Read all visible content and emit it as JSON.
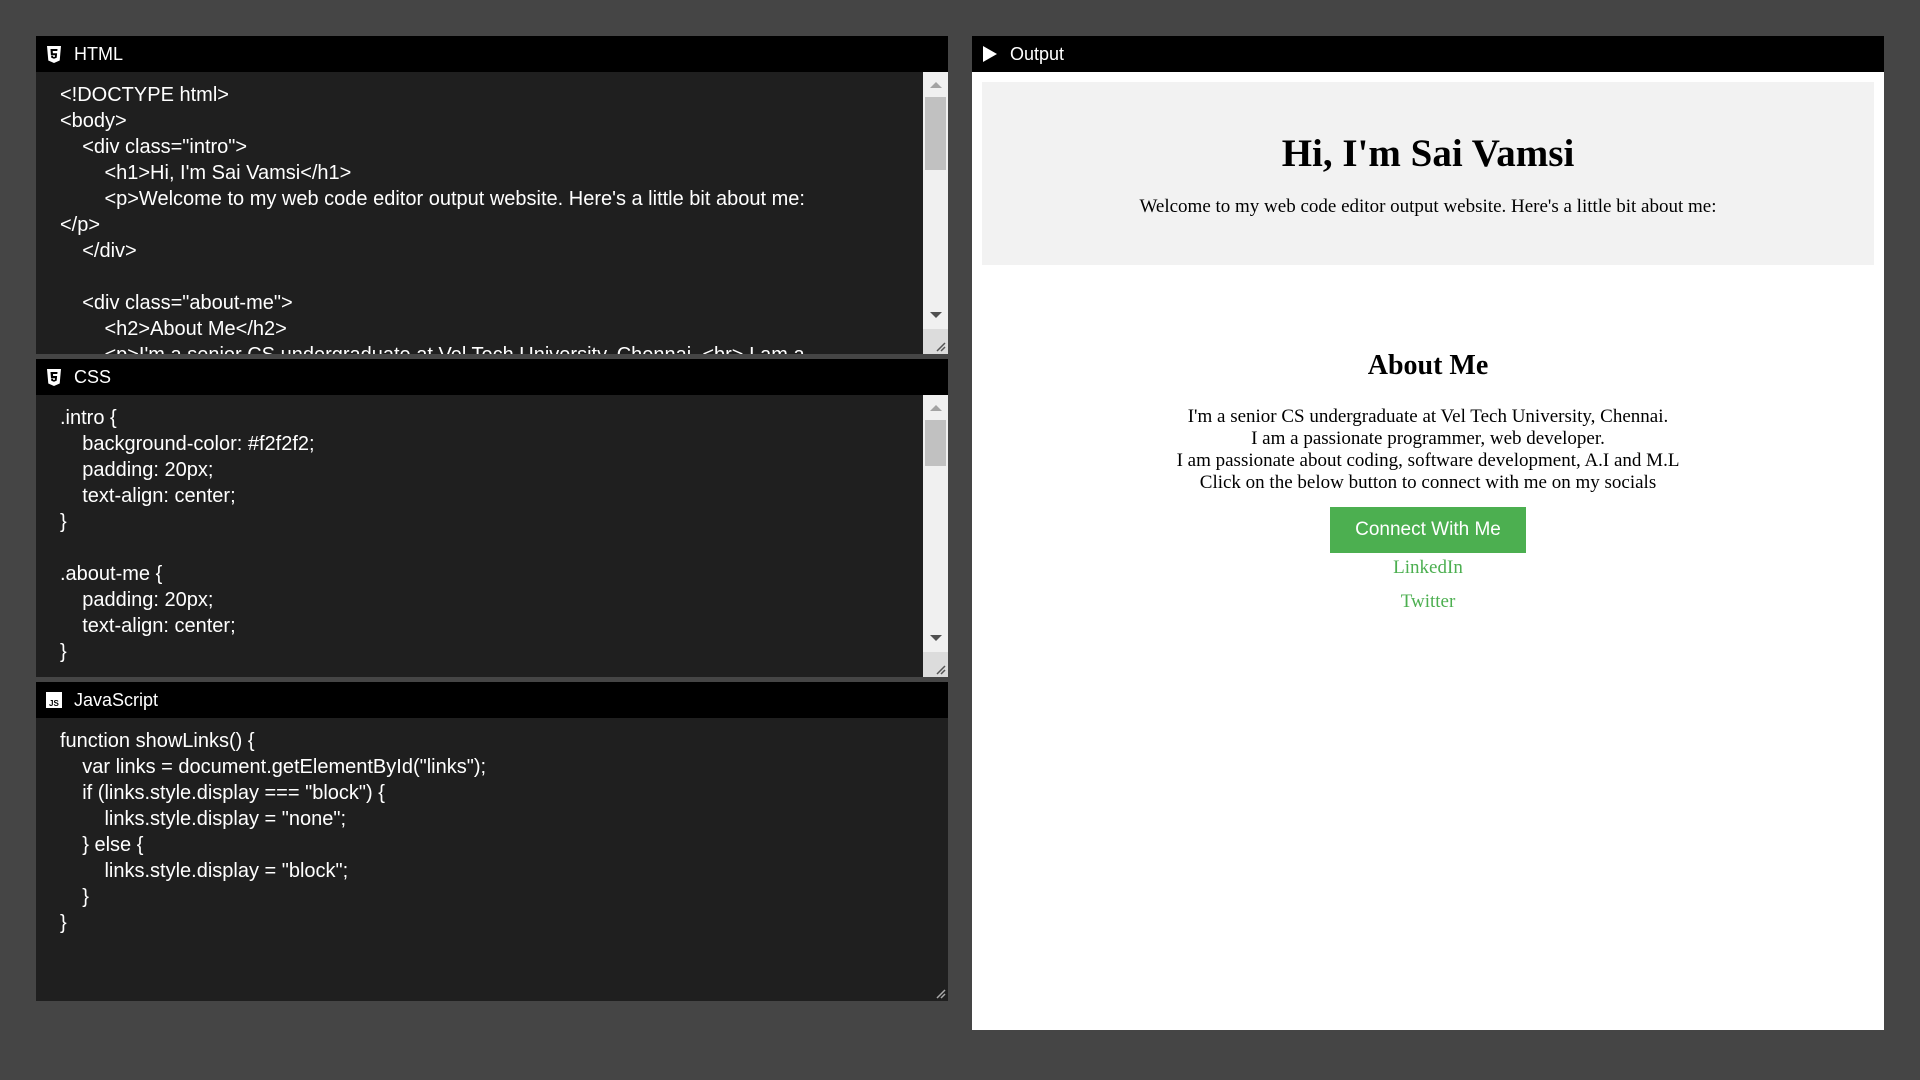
{
  "panels": {
    "html": {
      "title": "HTML",
      "icon": "html5-icon",
      "lines": [
        "<!DOCTYPE html>",
        "<body>",
        "    <div class=\"intro\">",
        "        <h1>Hi, I'm Sai Vamsi</h1>",
        "        <p>Welcome to my web code editor output website. Here's a little bit about me:",
        "</p>",
        "    </div>",
        "",
        "    <div class=\"about-me\">",
        "        <h2>About Me</h2>",
        "        <p>I'm a senior CS undergraduate at Vel Tech University, Chennai. <br> I am a"
      ],
      "scroll_position": 0.0
    },
    "css": {
      "title": "CSS",
      "icon": "css3-icon",
      "lines": [
        ".intro {",
        "    background-color: #f2f2f2;",
        "    padding: 20px;",
        "    text-align: center;",
        "}",
        "",
        ".about-me {",
        "    padding: 20px;",
        "    text-align: center;",
        "}"
      ],
      "scroll_position": 0.0
    },
    "js": {
      "title": "JavaScript",
      "icon": "js-icon",
      "lines": [
        "function showLinks() {",
        "    var links = document.getElementById(\"links\");",
        "    if (links.style.display === \"block\") {",
        "        links.style.display = \"none\";",
        "    } else {",
        "        links.style.display = \"block\";",
        "    }",
        "}"
      ]
    },
    "output": {
      "title": "Output",
      "icon": "play-icon"
    }
  },
  "preview": {
    "intro_heading": "Hi, I'm Sai Vamsi",
    "intro_text": "Welcome to my web code editor output website. Here's a little bit about me:",
    "about_heading": "About Me",
    "bio_lines": [
      "I'm a senior CS undergraduate at Vel Tech University, Chennai.",
      "I am a passionate programmer, web developer.",
      "I am passionate about coding, software development, A.I and M.L",
      "Click on the below button to connect with me on my socials"
    ],
    "connect_button": "Connect With Me",
    "links": [
      "LinkedIn",
      "Twitter"
    ],
    "colors": {
      "intro_bg": "#f2f2f2",
      "accent": "#4caf50"
    }
  }
}
